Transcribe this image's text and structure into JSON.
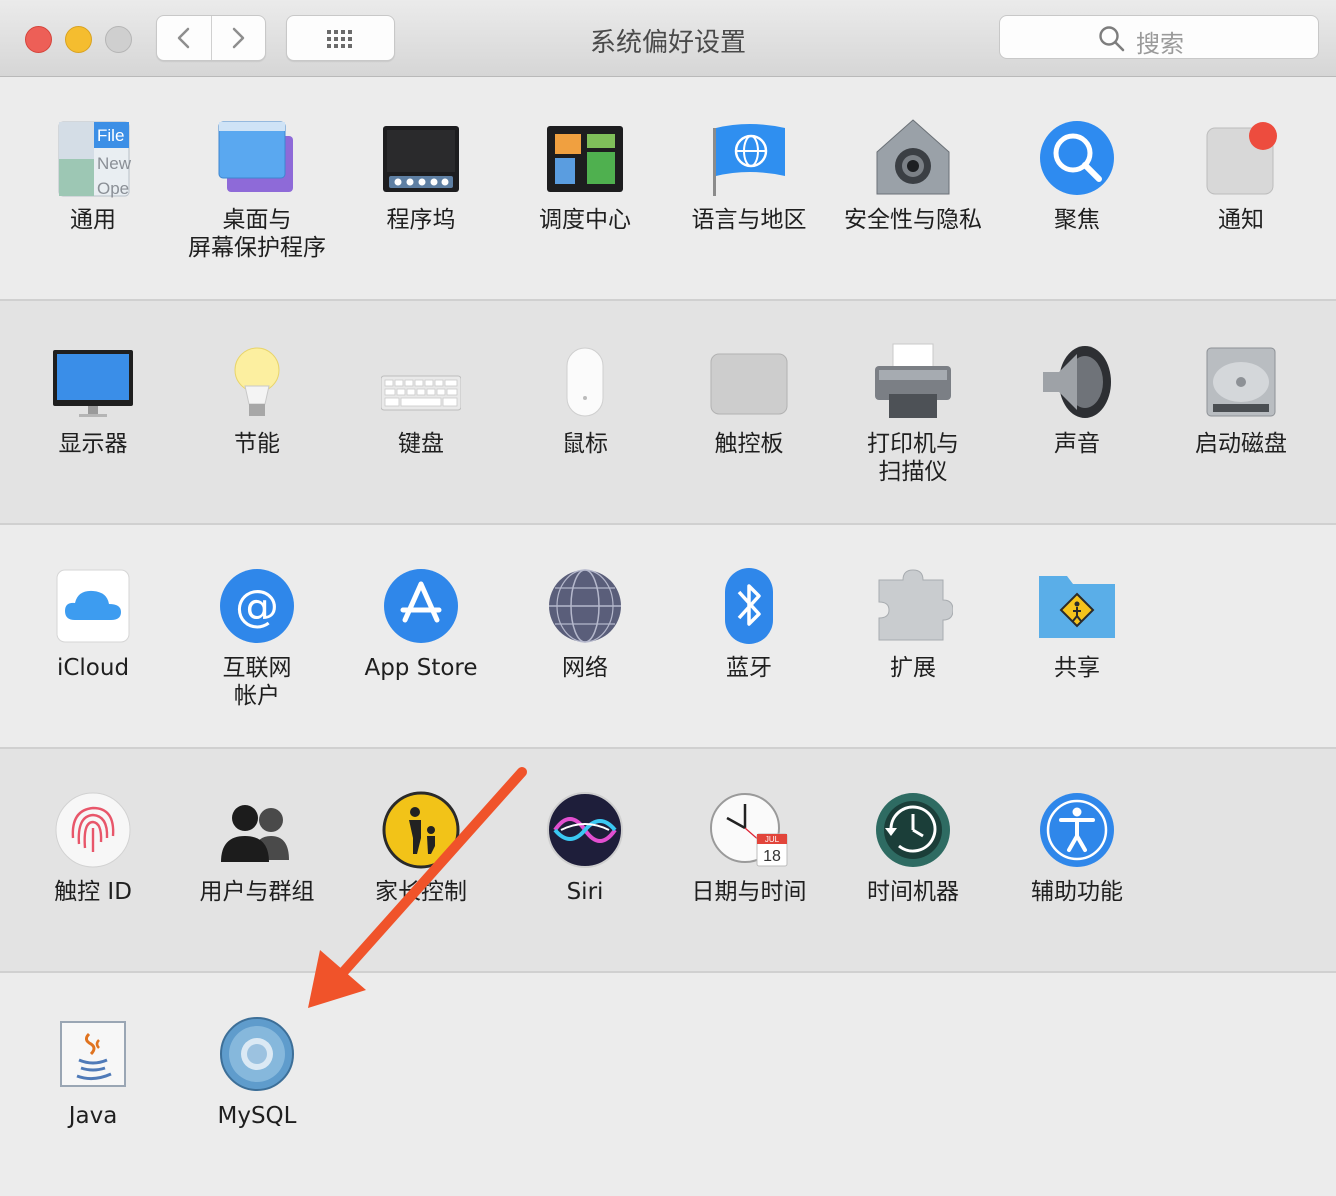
{
  "window": {
    "title": "系统偏好设置"
  },
  "search": {
    "placeholder": "搜索"
  },
  "rows": [
    [
      {
        "label": "通用",
        "icon": "general-icon"
      },
      {
        "label": "桌面与\n屏幕保护程序",
        "icon": "desktop-icon"
      },
      {
        "label": "程序坞",
        "icon": "dock-icon"
      },
      {
        "label": "调度中心",
        "icon": "mission-control-icon"
      },
      {
        "label": "语言与地区",
        "icon": "language-region-icon"
      },
      {
        "label": "安全性与隐私",
        "icon": "security-icon"
      },
      {
        "label": "聚焦",
        "icon": "spotlight-icon"
      },
      {
        "label": "通知",
        "icon": "notifications-icon"
      }
    ],
    [
      {
        "label": "显示器",
        "icon": "display-icon"
      },
      {
        "label": "节能",
        "icon": "energy-saver-icon"
      },
      {
        "label": "键盘",
        "icon": "keyboard-icon"
      },
      {
        "label": "鼠标",
        "icon": "mouse-icon"
      },
      {
        "label": "触控板",
        "icon": "trackpad-icon"
      },
      {
        "label": "打印机与\n扫描仪",
        "icon": "printer-icon"
      },
      {
        "label": "声音",
        "icon": "sound-icon"
      },
      {
        "label": "启动磁盘",
        "icon": "startup-disk-icon"
      }
    ],
    [
      {
        "label": "iCloud",
        "icon": "icloud-icon"
      },
      {
        "label": "互联网\n帐户",
        "icon": "internet-accounts-icon"
      },
      {
        "label": "App Store",
        "icon": "app-store-icon"
      },
      {
        "label": "网络",
        "icon": "network-icon"
      },
      {
        "label": "蓝牙",
        "icon": "bluetooth-icon"
      },
      {
        "label": "扩展",
        "icon": "extensions-icon"
      },
      {
        "label": "共享",
        "icon": "sharing-icon"
      }
    ],
    [
      {
        "label": "触控 ID",
        "icon": "touch-id-icon"
      },
      {
        "label": "用户与群组",
        "icon": "users-groups-icon"
      },
      {
        "label": "家长控制",
        "icon": "parental-controls-icon"
      },
      {
        "label": "Siri",
        "icon": "siri-icon"
      },
      {
        "label": "日期与时间",
        "icon": "date-time-icon"
      },
      {
        "label": "时间机器",
        "icon": "time-machine-icon"
      },
      {
        "label": "辅助功能",
        "icon": "accessibility-icon"
      }
    ],
    [
      {
        "label": "Java",
        "icon": "java-icon"
      },
      {
        "label": "MySQL",
        "icon": "mysql-icon"
      }
    ]
  ],
  "calendar": {
    "month": "JUL",
    "day": "18"
  },
  "colors": {
    "close": "#ed5f57",
    "minimize": "#f5bd2f",
    "zoom": "#c9c9c9",
    "arrow": "#f0532a"
  }
}
